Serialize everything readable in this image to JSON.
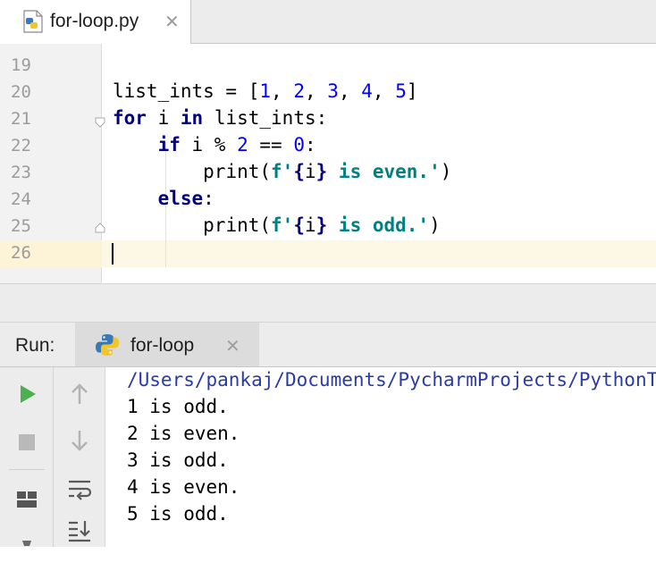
{
  "editor_tab": {
    "filename": "for-loop.py",
    "close_glyph": "✕"
  },
  "editor": {
    "lines": [
      {
        "num": "19"
      },
      {
        "num": "20"
      },
      {
        "num": "21"
      },
      {
        "num": "22"
      },
      {
        "num": "23"
      },
      {
        "num": "24"
      },
      {
        "num": "25"
      },
      {
        "num": "26"
      }
    ],
    "code": {
      "l20_var": "list_ints = [",
      "l20_n1": "1",
      "l20_c1": ", ",
      "l20_n2": "2",
      "l20_c2": ", ",
      "l20_n3": "3",
      "l20_c3": ", ",
      "l20_n4": "4",
      "l20_c4": ", ",
      "l20_n5": "5",
      "l20_end": "]",
      "l21_for": "for",
      "l21_mid": " i ",
      "l21_in": "in",
      "l21_rest": " list_ints:",
      "l22_indent": "    ",
      "l22_if": "if",
      "l22_mid": " i % ",
      "l22_n2": "2",
      "l22_eq": " == ",
      "l22_n0": "0",
      "l22_colon": ":",
      "l23_indent": "        ",
      "l23_print": "print(",
      "l23_str1": "f'",
      "l23_brace1": "{",
      "l23_var": "i",
      "l23_brace2": "}",
      "l23_str2": " is even.'",
      "l23_end": ")",
      "l24_indent": "    ",
      "l24_else": "else",
      "l24_colon": ":",
      "l25_indent": "        ",
      "l25_print": "print(",
      "l25_str1": "f'",
      "l25_brace1": "{",
      "l25_var": "i",
      "l25_brace2": "}",
      "l25_str2": " is odd.'",
      "l25_end": ")"
    }
  },
  "run_panel": {
    "label": "Run:",
    "tab_label": "for-loop",
    "close_glyph": "✕",
    "console": [
      "/Users/pankaj/Documents/PycharmProjects/PythonTutorial",
      "1 is odd.",
      "2 is even.",
      "3 is odd.",
      "4 is even.",
      "5 is odd."
    ]
  },
  "colors": {
    "keyword": "#000080",
    "number": "#0000ff",
    "string": "#008080",
    "run_green": "#4caf50",
    "current_line": "#fdf8e5"
  },
  "icons": [
    "python-file-icon",
    "python-icon",
    "run-icon",
    "stop-icon",
    "up-arrow-icon",
    "down-arrow-icon",
    "layout-icon",
    "soft-wrap-icon",
    "scroll-to-end-icon"
  ]
}
